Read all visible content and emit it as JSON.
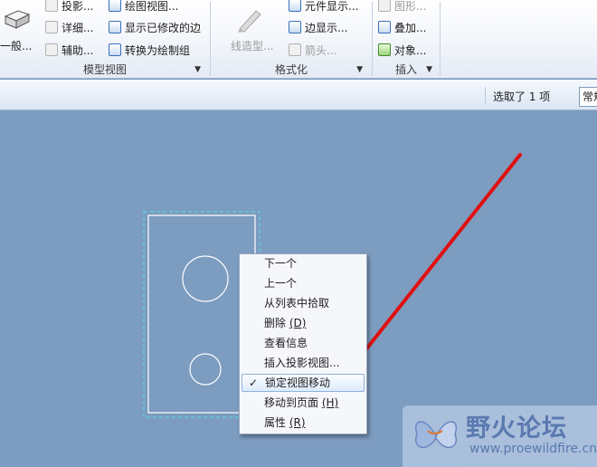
{
  "ribbon": {
    "model_views": {
      "footer": "模型视图",
      "general_partial": "一般...",
      "projection": "投影...",
      "detail": "详细...",
      "auxiliary": "辅助...",
      "drawing_view": "绘图视图...",
      "show_modified_edges": "显示已修改的边",
      "convert_to_draw_group": "转换为绘制组"
    },
    "format": {
      "footer": "格式化",
      "line_style": "线造型...",
      "element_display": "元件显示...",
      "edge_display": "边显示...",
      "arrows": "箭头..."
    },
    "insert": {
      "footer": "插入",
      "graphics": "图形...",
      "overlay": "叠加...",
      "object": "对象..."
    }
  },
  "statusbar": {
    "selection_text": "选取了 1 项",
    "filter_value": "常规"
  },
  "context_menu": {
    "items": [
      {
        "label": "下一个",
        "key": ""
      },
      {
        "label": "上一个",
        "key": ""
      },
      {
        "label": "从列表中拾取",
        "key": ""
      },
      {
        "label": "删除",
        "key": "(D)"
      },
      {
        "label": "查看信息",
        "key": ""
      },
      {
        "label": "插入投影视图...",
        "key": ""
      },
      {
        "label": "锁定视图移动",
        "key": "",
        "checked": true
      },
      {
        "label": "移动到页面",
        "key": "(H)"
      },
      {
        "label": "属性",
        "key": "(R)"
      }
    ],
    "check_glyph": "✓"
  },
  "watermark": {
    "title": "野火论坛",
    "url": "www.proewildfire.cn"
  },
  "colors": {
    "canvas_bg": "#7c9cc0",
    "arrow": "#e01010",
    "drawing_lines": "#ffffff",
    "selection_outline": "#57e0e8"
  }
}
